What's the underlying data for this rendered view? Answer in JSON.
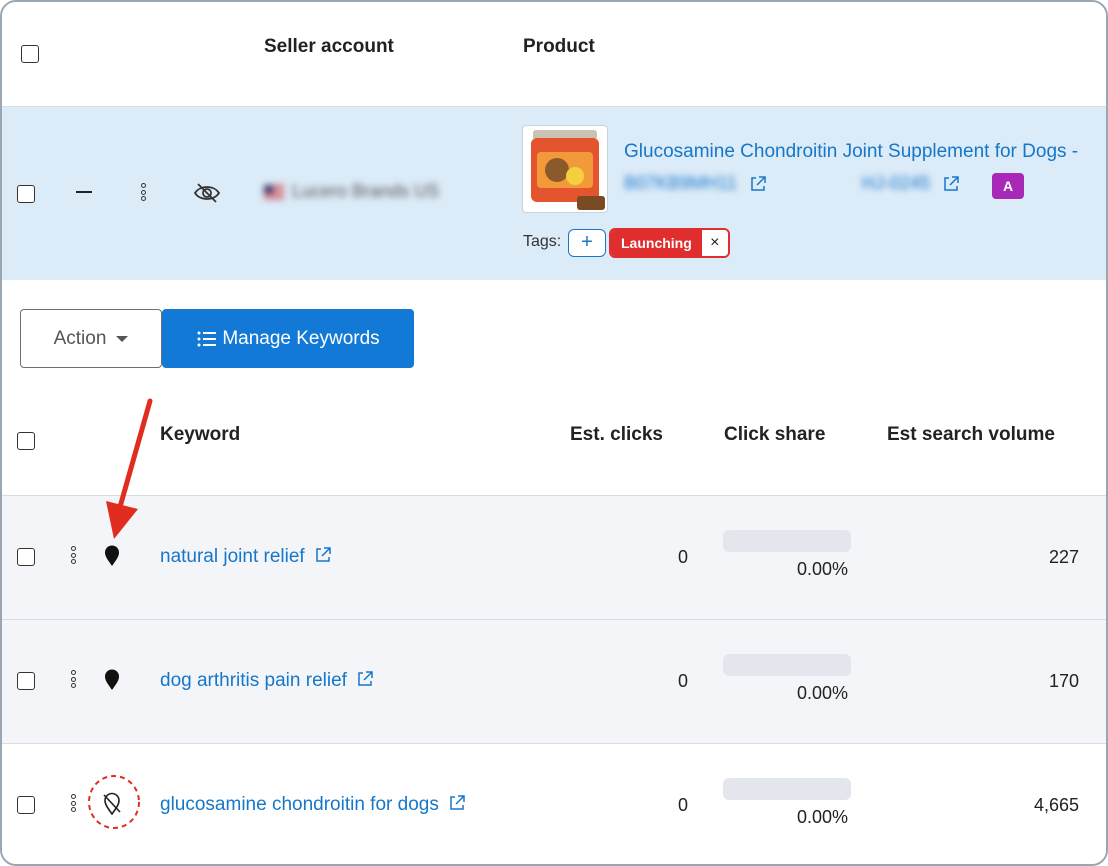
{
  "header": {
    "seller_account": "Seller account",
    "product": "Product"
  },
  "product_row": {
    "seller_name": "Lucero Brands US",
    "title": "Glucosamine Chondroitin Joint Supplement for Dogs -",
    "asin": "B07KB9MH11",
    "sku": "HJ-0245",
    "badge": "A",
    "tags_label": "Tags:",
    "add_tag": "+",
    "tag": "Launching",
    "tag_remove": "×",
    "colors": {
      "row_bg": "#dcebf8",
      "tag": "#e02d2d",
      "badge": "#a829b8",
      "link": "#1677c9"
    }
  },
  "toolbar": {
    "action_label": "Action",
    "manage_label": "Manage Keywords"
  },
  "keyword_header": {
    "keyword": "Keyword",
    "est_clicks": "Est. clicks",
    "click_share": "Click share",
    "search_volume": "Est search volume"
  },
  "keywords": [
    {
      "keyword": "natural joint relief",
      "est_clicks": "0",
      "click_share": "0.00%",
      "search_volume": "227",
      "pinned": true
    },
    {
      "keyword": "dog arthritis pain relief",
      "est_clicks": "0",
      "click_share": "0.00%",
      "search_volume": "170",
      "pinned": true
    },
    {
      "keyword": "glucosamine chondroitin for dogs",
      "est_clicks": "0",
      "click_share": "0.00%",
      "search_volume": "4,665",
      "pinned": false
    }
  ]
}
